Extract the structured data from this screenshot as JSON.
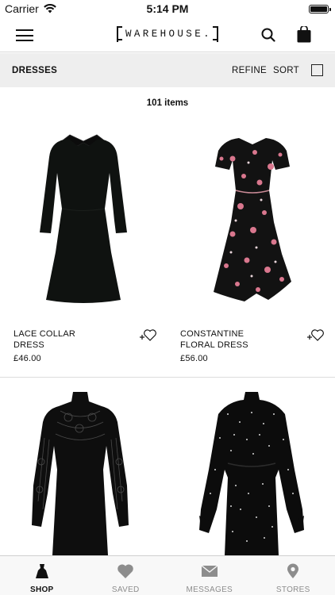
{
  "status_bar": {
    "carrier": "Carrier",
    "time": "5:14 PM"
  },
  "header": {
    "logo_text": "WAREHOUSE."
  },
  "filter_bar": {
    "category": "DRESSES",
    "refine_label": "REFINE",
    "sort_label": "SORT"
  },
  "item_count": "101 items",
  "products": [
    {
      "name": "LACE COLLAR DRESS",
      "price": "£46.00"
    },
    {
      "name": "CONSTANTINE FLORAL DRESS",
      "price": "£56.00"
    },
    {
      "name": "",
      "price": ""
    },
    {
      "name": "",
      "price": ""
    }
  ],
  "tabs": [
    {
      "label": "SHOP",
      "icon": "dress-icon",
      "active": true
    },
    {
      "label": "SAVED",
      "icon": "heart-icon",
      "active": false
    },
    {
      "label": "MESSAGES",
      "icon": "envelope-icon",
      "active": false
    },
    {
      "label": "STORES",
      "icon": "location-pin-icon",
      "active": false
    }
  ],
  "colors": {
    "accent": "#111111",
    "filter_bg": "#eeeeee",
    "tab_inactive": "#8d8d8d"
  }
}
